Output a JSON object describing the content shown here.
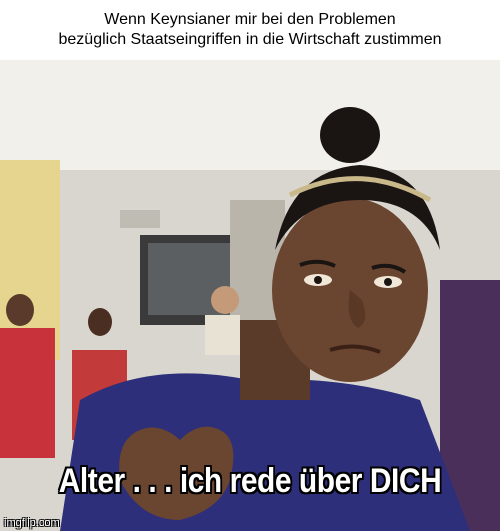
{
  "meme": {
    "top_line_1": "Wenn Keynsianer mir bei den Problemen",
    "top_line_2": "bezüglich Staatseingriffen in die Wirtschaft zustimmen",
    "bottom_caption": "Alter . . . ich rede über DICH",
    "watermark": "imgflip.com"
  }
}
